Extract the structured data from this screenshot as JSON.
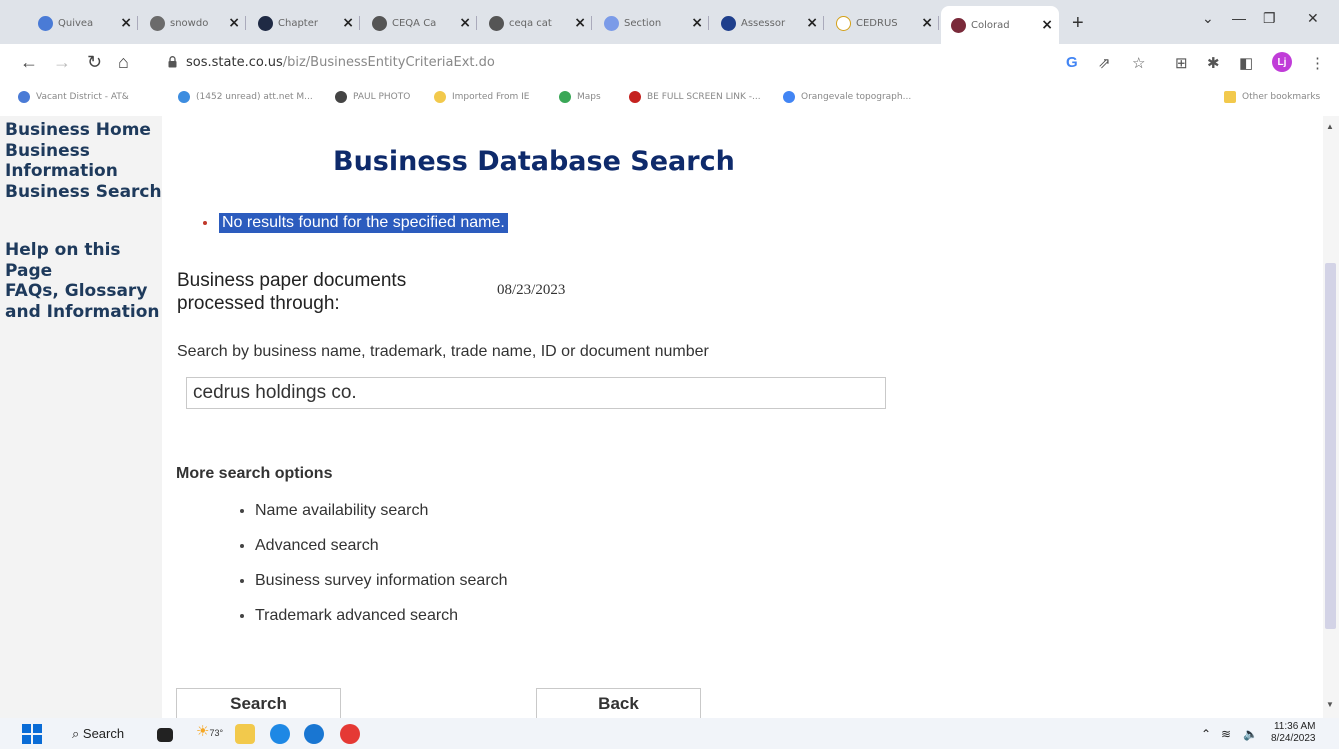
{
  "browser": {
    "tabs": [
      {
        "title": "Quivea",
        "color": "#4a7bd6"
      },
      {
        "title": "snowdo",
        "color": "#6b6b6b"
      },
      {
        "title": "Chapter",
        "color": "#1f2a44"
      },
      {
        "title": "CEQA Ca",
        "color": "#555555"
      },
      {
        "title": "ceqa cat",
        "color": "#555555"
      },
      {
        "title": "Section",
        "color": "#7b9be8"
      },
      {
        "title": "Assessor",
        "color": "#1f3f8c"
      },
      {
        "title": "CEDRUS",
        "color": "#ffffff"
      },
      {
        "title": "Colorad",
        "color": "#7a2a3a"
      }
    ],
    "url_host": "sos.state.co.us",
    "url_path": "/biz/BusinessEntityCriteriaExt.do",
    "profile_initial": "Lj",
    "bookmarks": [
      {
        "label": "Vacant District - AT&",
        "color": "#4a7bd6"
      },
      {
        "label": "(1452 unread) att.net M...",
        "color": "#3d8de0"
      },
      {
        "label": "PAUL PHOTO",
        "color": "#444444"
      },
      {
        "label": "Imported From IE",
        "color": "#f2c94c"
      },
      {
        "label": "Maps",
        "color": "#3aa757"
      },
      {
        "label": "BE FULL SCREEN LINK -...",
        "color": "#c5221f"
      },
      {
        "label": "Orangevale topograph...",
        "color": "#4285f4"
      }
    ],
    "other_bookmarks": "Other bookmarks"
  },
  "sidebar": {
    "links": [
      "Business Home",
      "Business Information",
      "Business Search"
    ],
    "help_links": [
      "Help on this Page",
      "FAQs, Glossary and Information"
    ]
  },
  "main": {
    "title": "Business Database Search",
    "error": "No results found for the specified name.",
    "docs_label": "Business paper documents processed through:",
    "docs_date": "08/23/2023",
    "search_label": "Search by business name, trademark, trade name, ID or document number",
    "search_value": "cedrus holdings co.",
    "more_heading": "More search options",
    "more_options": [
      "Name availability search",
      "Advanced search",
      "Business survey information search",
      "Trademark advanced search"
    ],
    "search_button": "Search",
    "back_button": "Back"
  },
  "taskbar": {
    "search_label": "Search",
    "weather_temp": "73°",
    "time": "11:36 AM",
    "date": "8/24/2023"
  }
}
